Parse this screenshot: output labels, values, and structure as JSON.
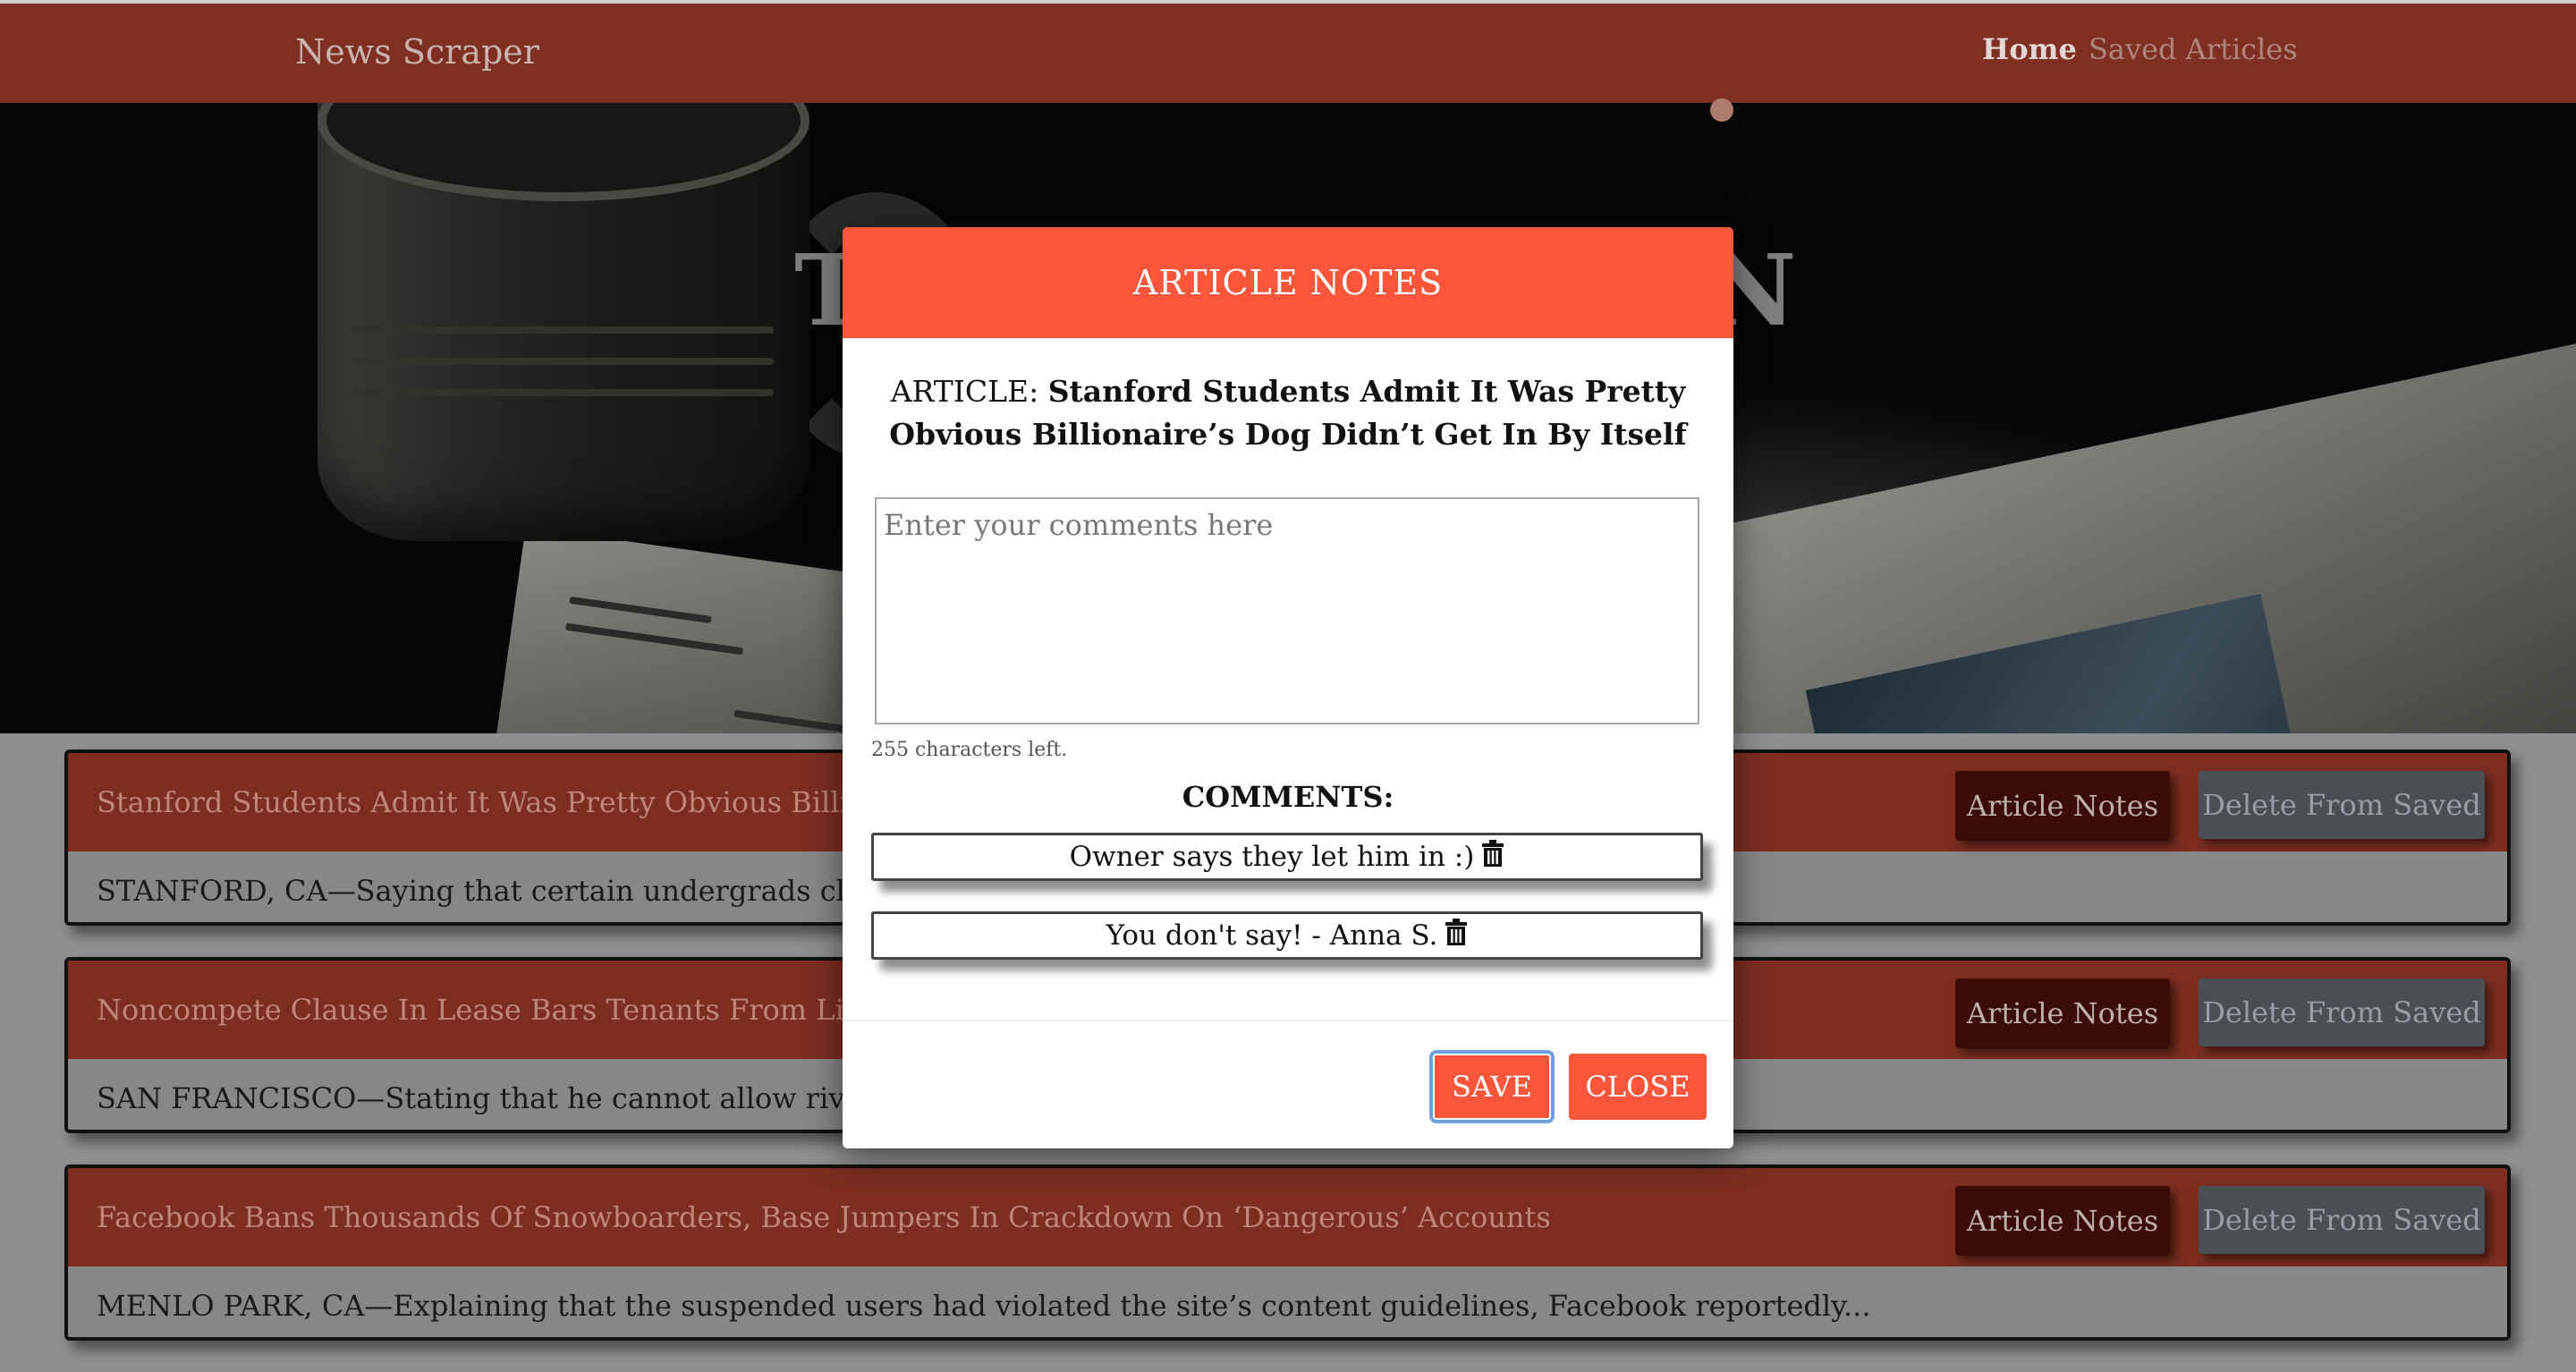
{
  "navbar": {
    "brand": "News Scraper",
    "links": [
      {
        "label": "Home"
      },
      {
        "label": "Saved Articles"
      }
    ]
  },
  "hero": {
    "title_fragment_left": "T",
    "title_fragment_right": "N"
  },
  "articles": [
    {
      "title": "Stanford Students Admit It Was Pretty Obvious Billionaire’s",
      "summary": "STANFORD, CA—Saying that certain undergrads clearly ha",
      "notes_label": "Article Notes",
      "delete_label": "Delete From Saved"
    },
    {
      "title": "Noncompete Clause In Lease Bars Tenants From Living An",
      "summary": "SAN FRANCISCO—Stating that he cannot allow rival prope",
      "notes_label": "Article Notes",
      "delete_label": "Delete From Saved"
    },
    {
      "title": "Facebook Bans Thousands Of Snowboarders, Base Jumpers In Crackdown On ‘Dangerous’ Accounts",
      "summary": "MENLO PARK, CA—Explaining that the suspended users had violated the site’s content guidelines, Facebook reportedly...",
      "notes_label": "Article Notes",
      "delete_label": "Delete From Saved"
    }
  ],
  "modal": {
    "title": "ARTICLE NOTES",
    "article_prefix": "ARTICLE:",
    "article_title": "Stanford Students Admit It Was Pretty Obvious Billionaire’s Dog Didn’t Get In By Itself",
    "comment_placeholder": "Enter your comments here",
    "comment_value": "",
    "chars_left": "255 characters left.",
    "comments_heading": "COMMENTS:",
    "comments": [
      {
        "text": "Owner says they let him in :)",
        "icon": "trash-icon"
      },
      {
        "text": "You don't say! - Anna S.",
        "icon": "trash-icon"
      }
    ],
    "save_label": "SAVE",
    "close_label": "CLOSE"
  },
  "colors": {
    "navbar": "#803023",
    "modal_accent": "#fb563c",
    "card_header": "#7d2e21",
    "notes_button": "#3a0b07",
    "delete_button": "#4b4f54"
  }
}
